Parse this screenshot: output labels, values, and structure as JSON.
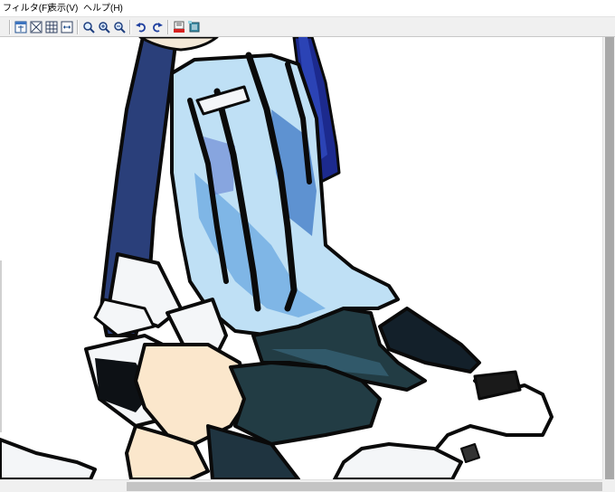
{
  "menubar": {
    "items": [
      {
        "label": "フィルタ(F)"
      },
      {
        "label": "表示(V)"
      },
      {
        "label": "ヘルプ(H)"
      }
    ]
  },
  "toolbar": {
    "buttons": [
      {
        "icon": "fit-window-icon"
      },
      {
        "icon": "fit-screen-icon"
      },
      {
        "icon": "actual-size-icon"
      },
      {
        "icon": "fit-width-icon"
      },
      {
        "icon": "zoom-icon"
      },
      {
        "icon": "zoom-in-icon"
      },
      {
        "icon": "zoom-out-icon"
      },
      {
        "icon": "rotate-left-icon"
      },
      {
        "icon": "rotate-right-icon"
      },
      {
        "icon": "filter-red-icon"
      },
      {
        "icon": "filter-settings-icon"
      }
    ]
  },
  "canvas": {
    "content": "anime-illustration",
    "colors": {
      "outline": "#0a0a0a",
      "shirt_light": "#bfe0f5",
      "shirt_mid": "#7fb6e6",
      "shirt_dark": "#3d78c4",
      "navy": "#1b2a8f",
      "pants": "#223c44",
      "skin": "#fbe7cc",
      "socks_white": "#f4f4f4"
    }
  }
}
